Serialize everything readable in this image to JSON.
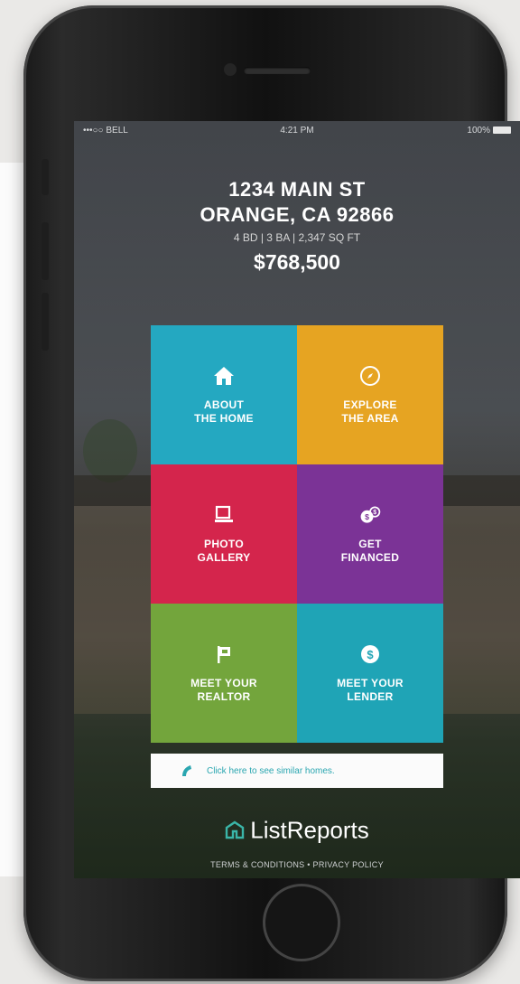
{
  "status_bar": {
    "carrier": "•••○○ BELL",
    "time": "4:21 PM",
    "battery": "100%"
  },
  "property": {
    "address_line1": "1234 MAIN ST",
    "address_line2": "ORANGE, CA 92866",
    "details": "4 BD | 3 BA | 2,347 SQ FT",
    "price": "$768,500"
  },
  "tiles": [
    {
      "line1": "ABOUT",
      "line2": "THE HOME",
      "color": "#24a8c1",
      "icon": "home-icon"
    },
    {
      "line1": "EXPLORE",
      "line2": "THE AREA",
      "color": "#e6a422",
      "icon": "compass-icon"
    },
    {
      "line1": "PHOTO",
      "line2": "GALLERY",
      "color": "#d4254c",
      "icon": "photo-icon"
    },
    {
      "line1": "GET",
      "line2": "FINANCED",
      "color": "#7b3396",
      "icon": "money-icon"
    },
    {
      "line1": "MEET YOUR",
      "line2": "REALTOR",
      "color": "#73a53c",
      "icon": "flag-icon"
    },
    {
      "line1": "MEET YOUR",
      "line2": "LENDER",
      "color": "#1fa4b6",
      "icon": "dollar-icon"
    }
  ],
  "cta": {
    "text": "Click here to see similar homes.",
    "color": "#2aa6b0"
  },
  "brand": {
    "name": "ListReports"
  },
  "footer": {
    "text": "TERMS & CONDITIONS • PRIVACY POLICY"
  }
}
